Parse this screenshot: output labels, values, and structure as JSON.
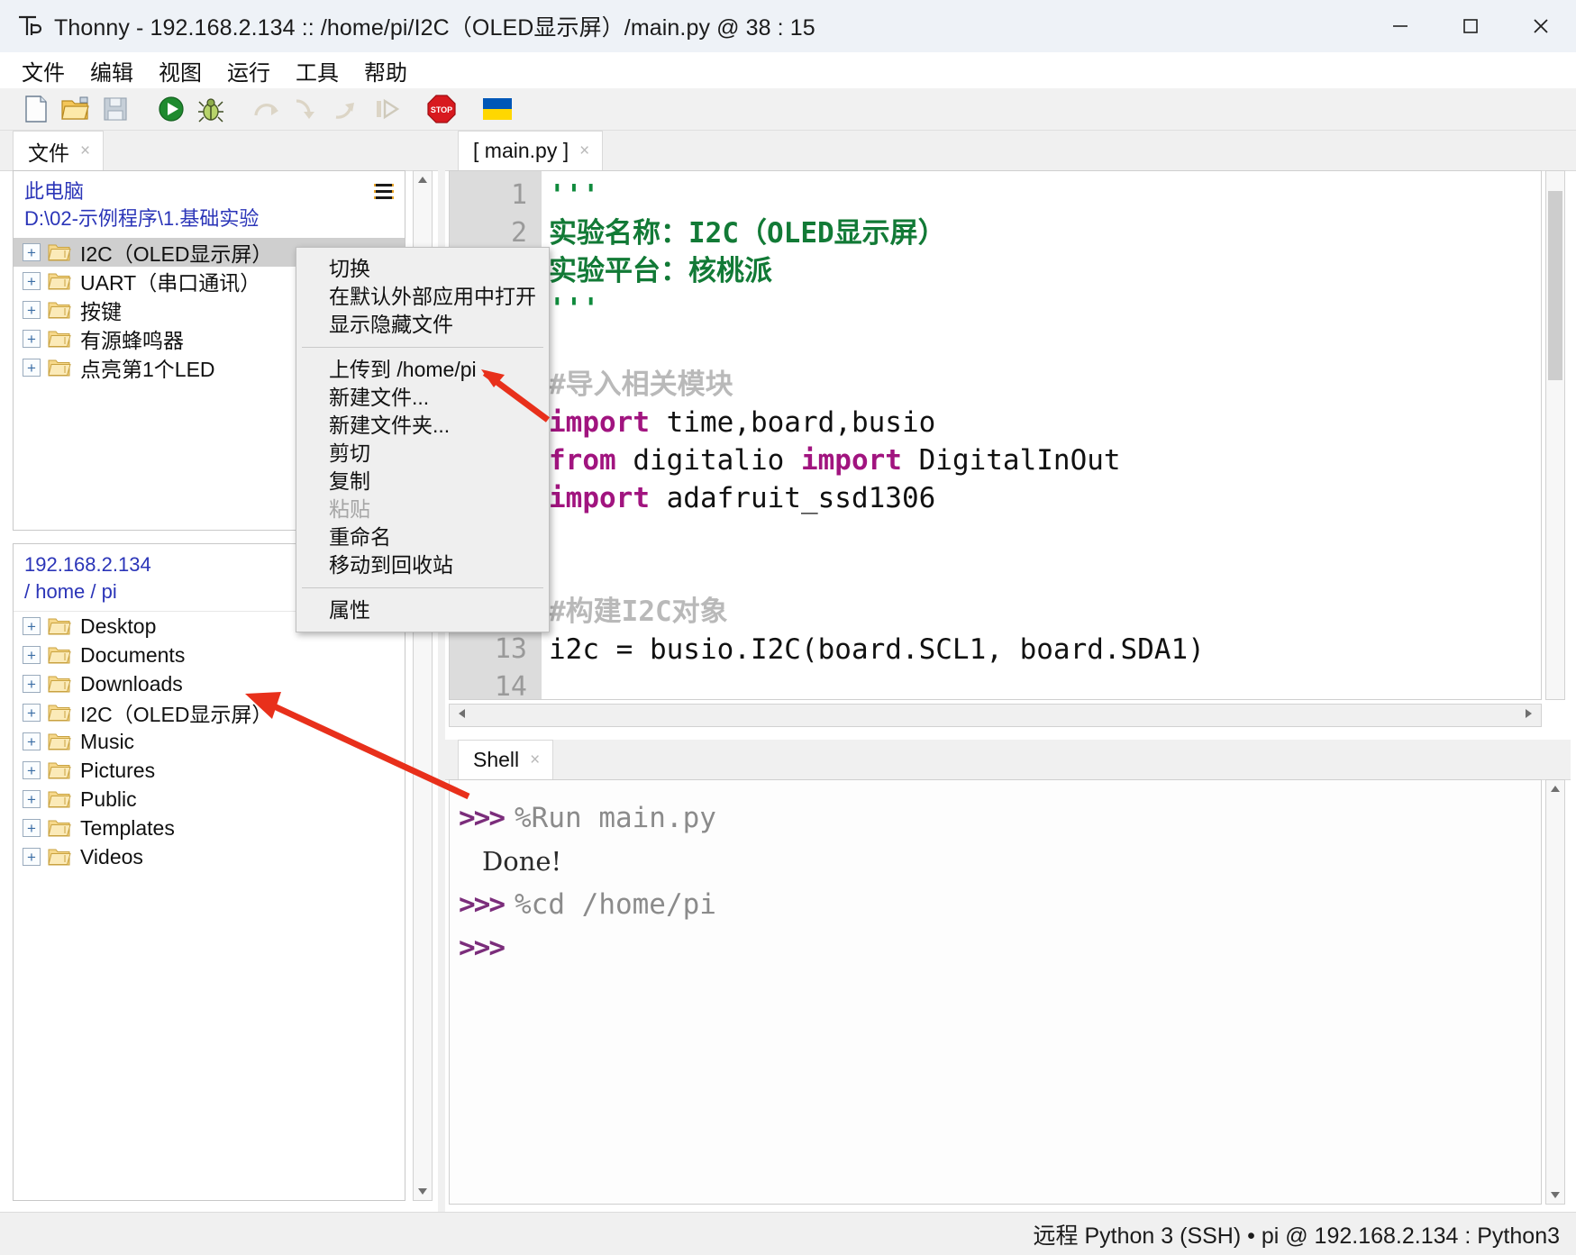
{
  "window": {
    "app_name": "Thonny",
    "title": "Thonny  -  192.168.2.134 :: /home/pi/I2C（OLED显示屏）/main.py  @  38 : 15",
    "minimize": "—",
    "maximize": "▢",
    "close": "✕"
  },
  "menubar": {
    "items": [
      {
        "label": "文件"
      },
      {
        "label": "编辑"
      },
      {
        "label": "视图"
      },
      {
        "label": "运行"
      },
      {
        "label": "工具"
      },
      {
        "label": "帮助"
      }
    ]
  },
  "toolbar": {
    "buttons": [
      {
        "name": "new-file",
        "icon": "new-file-icon"
      },
      {
        "name": "open-file",
        "icon": "open-folder-icon"
      },
      {
        "name": "save-file",
        "icon": "save-disk-icon"
      },
      {
        "name": "run",
        "icon": "run-play-icon"
      },
      {
        "name": "debug",
        "icon": "debug-bug-icon"
      },
      {
        "name": "step-over",
        "icon": "step-over-icon"
      },
      {
        "name": "step-into",
        "icon": "step-into-icon"
      },
      {
        "name": "step-out",
        "icon": "step-out-icon"
      },
      {
        "name": "resume",
        "icon": "resume-icon"
      },
      {
        "name": "stop",
        "icon": "stop-icon"
      },
      {
        "name": "flag",
        "icon": "ukraine-flag-icon"
      }
    ]
  },
  "files_panel": {
    "tab_label": "文件",
    "tab_close": "×",
    "local": {
      "header_line1": "此电脑",
      "header_line2": "D:\\02-示例程序\\1.基础实验",
      "menu_icon": "hamburger-icon",
      "items": [
        {
          "label": "I2C（OLED显示屏）",
          "expander": "+",
          "selected": true
        },
        {
          "label": "UART（串口通讯）",
          "expander": "+",
          "selected": false
        },
        {
          "label": "按键",
          "expander": "+",
          "selected": false
        },
        {
          "label": "有源蜂鸣器",
          "expander": "+",
          "selected": false
        },
        {
          "label": "点亮第1个LED",
          "expander": "+",
          "selected": false
        }
      ]
    },
    "remote": {
      "header_line1": "192.168.2.134",
      "header_line2": "/ home / pi",
      "items": [
        {
          "label": "Desktop",
          "expander": "+"
        },
        {
          "label": "Documents",
          "expander": "+"
        },
        {
          "label": "Downloads",
          "expander": "+"
        },
        {
          "label": "I2C（OLED显示屏）",
          "expander": "+"
        },
        {
          "label": "Music",
          "expander": "+"
        },
        {
          "label": "Pictures",
          "expander": "+"
        },
        {
          "label": "Public",
          "expander": "+"
        },
        {
          "label": "Templates",
          "expander": "+"
        },
        {
          "label": "Videos",
          "expander": "+"
        }
      ]
    }
  },
  "context_menu": {
    "groups": [
      [
        {
          "label": "切换",
          "disabled": false
        },
        {
          "label": "在默认外部应用中打开",
          "disabled": false
        },
        {
          "label": "显示隐藏文件",
          "disabled": false
        }
      ],
      [
        {
          "label": "上传到 /home/pi",
          "disabled": false
        },
        {
          "label": "新建文件...",
          "disabled": false
        },
        {
          "label": "新建文件夹...",
          "disabled": false
        },
        {
          "label": "剪切",
          "disabled": false
        },
        {
          "label": "复制",
          "disabled": false
        },
        {
          "label": "粘贴",
          "disabled": true
        },
        {
          "label": "重命名",
          "disabled": false
        },
        {
          "label": "移动到回收站",
          "disabled": false
        }
      ],
      [
        {
          "label": "属性",
          "disabled": false
        }
      ]
    ]
  },
  "editor": {
    "tab_label": "[ main.py ]",
    "tab_close": "×",
    "lines": [
      {
        "num": "1",
        "segments": [
          {
            "text": "'''",
            "style": "str"
          }
        ]
      },
      {
        "num": "2",
        "segments": [
          {
            "text": "实验名称：I2C（OLED显示屏）",
            "style": "strq"
          }
        ]
      },
      {
        "num": "",
        "segments": [
          {
            "text": "实验平台：核桃派",
            "style": "strq"
          }
        ]
      },
      {
        "num": "",
        "segments": [
          {
            "text": "'''",
            "style": "str"
          }
        ]
      },
      {
        "num": "",
        "segments": [
          {
            "text": "",
            "style": "txt"
          }
        ]
      },
      {
        "num": "",
        "segments": [
          {
            "text": "#导入相关模块",
            "style": "com"
          }
        ]
      },
      {
        "num": "",
        "segments": [
          {
            "text": "import",
            "style": "kw"
          },
          {
            "text": " time,board,busio",
            "style": "txt"
          }
        ]
      },
      {
        "num": "",
        "segments": [
          {
            "text": "from",
            "style": "kw"
          },
          {
            "text": " digitalio ",
            "style": "txt"
          },
          {
            "text": "import",
            "style": "kw"
          },
          {
            "text": " DigitalInOut",
            "style": "txt"
          }
        ]
      },
      {
        "num": "",
        "segments": [
          {
            "text": "import",
            "style": "kw"
          },
          {
            "text": " adafruit_ssd1306",
            "style": "txt"
          }
        ]
      },
      {
        "num": "",
        "segments": [
          {
            "text": "",
            "style": "txt"
          }
        ]
      },
      {
        "num": "",
        "segments": [
          {
            "text": "",
            "style": "txt"
          }
        ]
      },
      {
        "num": "",
        "segments": [
          {
            "text": "#构建I2C对象",
            "style": "com"
          }
        ]
      },
      {
        "num": "13",
        "segments": [
          {
            "text": "i2c = busio.I2C(board.SCL1, board.SDA1)",
            "style": "txt"
          }
        ]
      },
      {
        "num": "14",
        "segments": [
          {
            "text": "",
            "style": "txt"
          }
        ]
      }
    ]
  },
  "shell": {
    "tab_label": "Shell",
    "tab_close": "×",
    "lines": [
      {
        "prompt": ">>>",
        "text": "%Run main.py",
        "kind": "command"
      },
      {
        "prompt": "",
        "text": "Done!",
        "kind": "output"
      },
      {
        "prompt": ">>>",
        "text": "%cd /home/pi",
        "kind": "command"
      },
      {
        "prompt": ">>>",
        "text": "",
        "kind": "command"
      }
    ]
  },
  "statusbar": {
    "text": "远程 Python 3 (SSH)  •  pi @ 192.168.2.134 : Python3"
  },
  "colors": {
    "accent_blue": "#2b35b8",
    "string_green": "#127a36",
    "keyword_magenta": "#a1147f",
    "comment_gray": "#b9b9b9",
    "prompt_purple": "#7b2d7b",
    "annotation_red": "#e8301b",
    "selection_gray": "#cfcfcf"
  }
}
